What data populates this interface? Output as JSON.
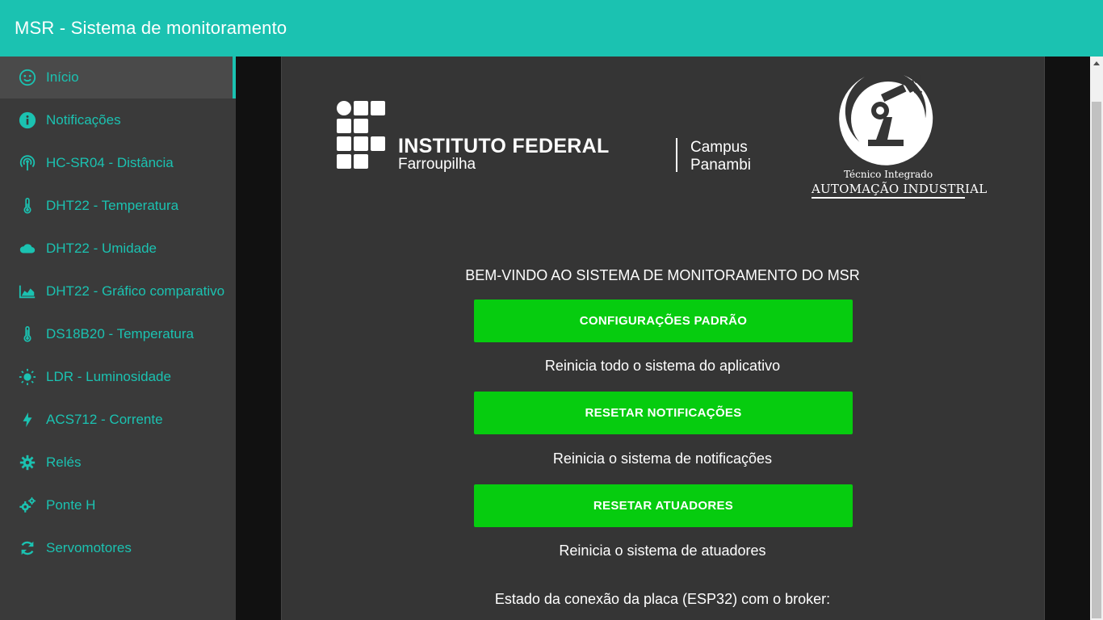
{
  "header": {
    "title": "MSR - Sistema de monitoramento"
  },
  "sidebar": {
    "items": [
      {
        "label": "Início",
        "icon": "smile-icon",
        "active": true
      },
      {
        "label": "Notificações",
        "icon": "info-icon"
      },
      {
        "label": "HC-SR04 - Distância",
        "icon": "broadcast-icon"
      },
      {
        "label": "DHT22 - Temperatura",
        "icon": "thermometer-icon"
      },
      {
        "label": "DHT22 - Umidade",
        "icon": "cloud-icon"
      },
      {
        "label": "DHT22 - Gráfico comparativo",
        "icon": "area-chart-icon"
      },
      {
        "label": "DS18B20 - Temperatura",
        "icon": "thermometer-icon"
      },
      {
        "label": "LDR - Luminosidade",
        "icon": "sun-icon"
      },
      {
        "label": "ACS712 - Corrente",
        "icon": "bolt-icon"
      },
      {
        "label": "Relés",
        "icon": "gear-icon"
      },
      {
        "label": "Ponte H",
        "icon": "gears-icon"
      },
      {
        "label": "Servomotores",
        "icon": "refresh-icon"
      }
    ]
  },
  "logos": {
    "institute_name": "INSTITUTO FEDERAL",
    "institute_sub": "Farroupilha",
    "campus_line1": "Campus",
    "campus_line2": "Panambi",
    "course_top": "Técnico Integrado",
    "course_main": "AUTOMAÇÃO INDUSTRIAL"
  },
  "main": {
    "welcome": "BEM-VINDO AO SISTEMA DE MONITORAMENTO DO MSR",
    "actions": [
      {
        "label": "CONFIGURAÇÕES PADRÃO",
        "description": "Reinicia todo o sistema do aplicativo"
      },
      {
        "label": "RESETAR NOTIFICAÇÕES",
        "description": "Reinicia o sistema de notificações"
      },
      {
        "label": "RESETAR ATUADORES",
        "description": "Reinicia o sistema de atuadores"
      }
    ],
    "connection_label": "Estado da conexão da placa (ESP32) com o broker:"
  },
  "colors": {
    "accent": "#1bc2b1",
    "button": "#06cc0f",
    "sidebar_bg": "#3a3a3a",
    "panel_bg": "#353535"
  }
}
